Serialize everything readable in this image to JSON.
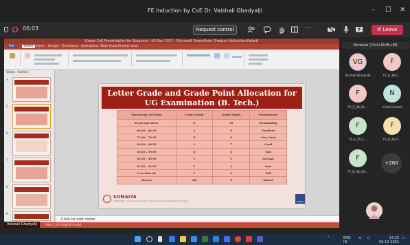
{
  "window": {
    "title": "FE Induction by CoE Dr. Vaishali Ghadyalji",
    "controls": [
      "–",
      "☐",
      "✕"
    ]
  },
  "toolbar": {
    "timer": "06:03",
    "request_control": "Request control",
    "leave": "Leave",
    "icons": [
      "people-icon",
      "chat-icon",
      "raise-hand-icon",
      "rooms-icon",
      "more-icon",
      "camera-icon",
      "mic-icon",
      "share-icon"
    ]
  },
  "ppt": {
    "title_bar": "Grade Cell Presentation for Students - 09 Dec 2021 - Microsoft PowerPoint (Product Activation Failed)",
    "menu": [
      "File",
      "Home",
      "Insert",
      "Design",
      "Transitions",
      "Animations",
      "Slide Show",
      "Review",
      "View"
    ],
    "thumbs_tabs": [
      "Slides",
      "Outline"
    ],
    "thumb_numbers": [
      "4",
      "5",
      "6",
      "7",
      "8",
      "9"
    ],
    "notes_placeholder": "Click to add notes",
    "status": "Slide 5 of 9   English (India)"
  },
  "slide": {
    "heading": "Letter Grade and Grade Point Allocation for UG Examination (B. Tech.)",
    "columns": [
      "Percentage of Marks",
      "Letter Grade",
      "Grade Points",
      "Performance"
    ],
    "rows": [
      [
        "85.00 and above",
        "O",
        "10",
        "Outstanding"
      ],
      [
        "80.00 – 84.99",
        "A",
        "9",
        "Excellent"
      ],
      [
        "74.00 – 79.99",
        "B",
        "8",
        "Very Good"
      ],
      [
        "60.00 – 69.99",
        "C",
        "7",
        "Good"
      ],
      [
        "50.00 – 59.99",
        "D",
        "6",
        "Fair"
      ],
      [
        "45.00 – 49.99",
        "E",
        "5",
        "Average"
      ],
      [
        "40.00 – 44.99",
        "P",
        "4",
        "Pass"
      ],
      [
        "Less than 40",
        "F",
        "0",
        "Fail"
      ],
      [
        "Absent",
        "AB",
        "0",
        "Absent"
      ]
    ],
    "logo_name": "SOMAIYA",
    "logo_sub": "VIDYAVIHAR",
    "logo_tag": "K J Somaiya Institute of Engineering and Information Technology",
    "corner_badge": "TRUST"
  },
  "presenter": "Vaishali Ghadyalji",
  "gallery": {
    "unmute_tip": "Unmute (Ctrl+Shift+M)",
    "participants": [
      {
        "initials": "VG",
        "name": "Vaishali Ghadyalji",
        "color": "#f2c9c5"
      },
      {
        "initials": "F",
        "name": "FY_A_38_C...",
        "color": "#f2c9c5"
      },
      {
        "initials": "F",
        "name": "FY_E_38_OL...",
        "color": "#f2c9c5"
      },
      {
        "initials": "N",
        "name": "ninad (Guest)",
        "color": "#bfe3dd"
      },
      {
        "initials": "F",
        "name": "FY_A_25_C...",
        "color": "#c9e5c8"
      },
      {
        "initials": "F",
        "name": "FY_D_20_IT...",
        "color": "#f5deb0"
      },
      {
        "initials": "F",
        "name": "FY_B_38_CO...",
        "color": "#c9e5c8"
      }
    ],
    "more_count": "+260"
  },
  "taskbar": {
    "lang": "ENG",
    "region": "IN",
    "time": "13:55",
    "date": "09-12-2021"
  }
}
